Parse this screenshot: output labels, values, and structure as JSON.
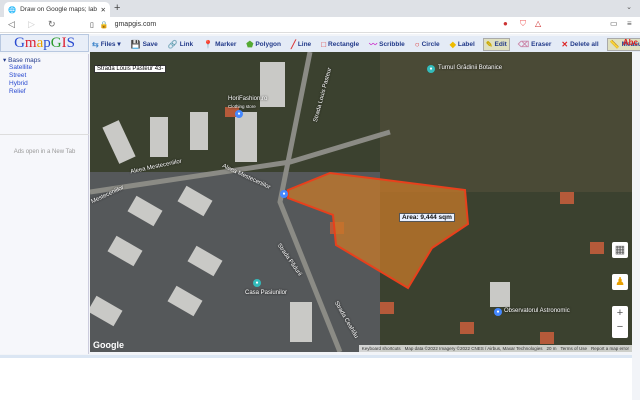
{
  "browser": {
    "tab_title": "Draw on Google maps; label, su",
    "url": "gmapgis.com"
  },
  "app": {
    "logo": "GmapGIS",
    "toolbar": [
      {
        "icon": "files-icon",
        "label": "Files ▾"
      },
      {
        "icon": "save-icon",
        "label": "Save"
      },
      {
        "icon": "link-icon",
        "label": "Link"
      },
      {
        "icon": "marker-icon",
        "label": "Marker"
      },
      {
        "icon": "polygon-icon",
        "label": "Polygon"
      },
      {
        "icon": "line-icon",
        "label": "Line"
      },
      {
        "icon": "rectangle-icon",
        "label": "Rectangle"
      },
      {
        "icon": "scribble-icon",
        "label": "Scribble"
      },
      {
        "icon": "circle-icon",
        "label": "Circle"
      },
      {
        "icon": "label-icon",
        "label": "Label"
      },
      {
        "icon": "edit-icon",
        "label": "Edit"
      },
      {
        "icon": "eraser-icon",
        "label": "Eraser"
      },
      {
        "icon": "delete-icon",
        "label": "Delete all"
      },
      {
        "icon": "measure-icon",
        "label": "Measure"
      }
    ],
    "abc": "Abc",
    "sidebar": {
      "heading": "Base maps",
      "items": [
        "Satellite",
        "Street",
        "Hybrid",
        "Relief"
      ],
      "ads": "Ads open in a New Tab"
    }
  },
  "map": {
    "address_label": "Strada Louis Pasteur 43-",
    "area_label": "Area: 9,444 sqm",
    "polygon_color": "#e8401c",
    "places": [
      "Turnul Grădinii Botanice",
      "HoriFashion.ro",
      "Clothing store",
      "Aleea Mesteceniilor",
      "Aleea Mesteceniilor",
      "Mesteceniilor",
      "Casa Pasiunilor",
      "Observatorul Astronomic",
      "Strada Ceahlău",
      "Strada Louis Pasteur",
      "Strada Pădurii"
    ],
    "google": "Google",
    "attribution": [
      "Keyboard shortcuts",
      "Map data ©2022 Imagery ©2022 CNES / Airbus, Maxar Technologies",
      "20 m",
      "Terms of Use",
      "Report a map error"
    ]
  }
}
